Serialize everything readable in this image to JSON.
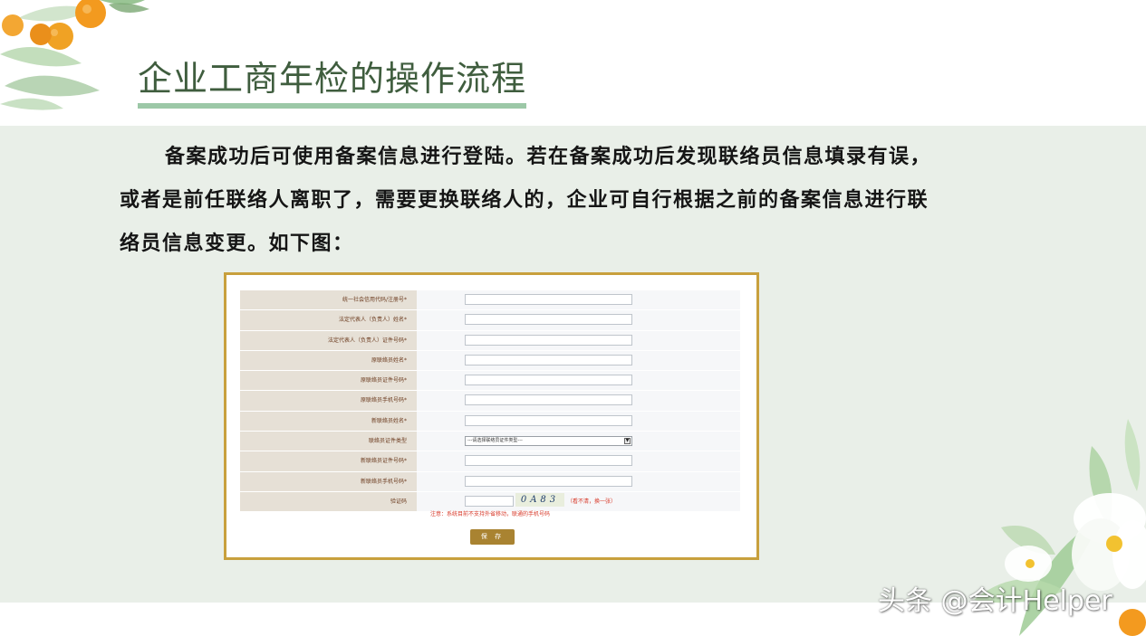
{
  "slide": {
    "title": "企业工商年检的操作流程",
    "paragraph_line1": "备案成功后可使用备案信息进行登陆。若在备案成功后发现联络员信息填录有误，",
    "paragraph_line2": "或者是前任联络人离职了，需要更换联络人的，企业可自行根据之前的备案信息进行联",
    "paragraph_line3": "络员信息变更。如下图："
  },
  "form": {
    "rows": [
      {
        "label": "统一社会信用代码/注册号*",
        "type": "text"
      },
      {
        "label": "法定代表人（负责人）姓名*",
        "type": "text"
      },
      {
        "label": "法定代表人（负责人）证件号码*",
        "type": "text"
      },
      {
        "label": "原联络员姓名*",
        "type": "text"
      },
      {
        "label": "原联络员证件号码*",
        "type": "text"
      },
      {
        "label": "原联络员手机号码*",
        "type": "text"
      },
      {
        "label": "新联络员姓名*",
        "type": "text"
      },
      {
        "label": "联络员证件类型",
        "type": "select"
      },
      {
        "label": "新联络员证件号码*",
        "type": "text"
      },
      {
        "label": "新联络员手机号码*",
        "type": "text"
      },
      {
        "label": "验证码",
        "type": "captcha"
      }
    ],
    "select_placeholder": "---请选择联络员证件类型---",
    "captcha_text": "0A83",
    "captcha_refresh": "（看不清，换一张）",
    "notice": "注意：系统目前不支持外省移动，联通的手机号码",
    "save_label": "保 存"
  },
  "watermark": "头条 @会计Helper",
  "colors": {
    "title": "#3f5d3e",
    "title_underline": "#9cc8a7",
    "band": "#e9efe8",
    "frame_border": "#c8a03d",
    "label_bg": "#e6e0d6",
    "label_text": "#6b3a1e",
    "save_button": "#a98331",
    "notice": "#d83a2a"
  }
}
